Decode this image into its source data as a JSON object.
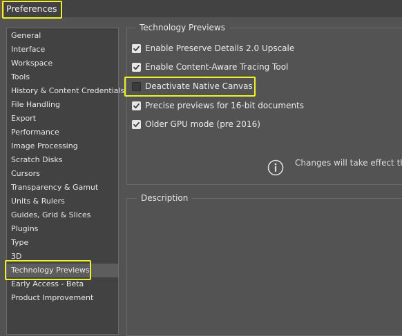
{
  "window": {
    "title": "Preferences"
  },
  "sidebar": {
    "items": [
      {
        "label": "General",
        "selected": false
      },
      {
        "label": "Interface",
        "selected": false
      },
      {
        "label": "Workspace",
        "selected": false
      },
      {
        "label": "Tools",
        "selected": false
      },
      {
        "label": "History & Content Credentials",
        "selected": false
      },
      {
        "label": "File Handling",
        "selected": false
      },
      {
        "label": "Export",
        "selected": false
      },
      {
        "label": "Performance",
        "selected": false
      },
      {
        "label": "Image Processing",
        "selected": false
      },
      {
        "label": "Scratch Disks",
        "selected": false
      },
      {
        "label": "Cursors",
        "selected": false
      },
      {
        "label": "Transparency & Gamut",
        "selected": false
      },
      {
        "label": "Units & Rulers",
        "selected": false
      },
      {
        "label": "Guides, Grid & Slices",
        "selected": false
      },
      {
        "label": "Plugins",
        "selected": false
      },
      {
        "label": "Type",
        "selected": false
      },
      {
        "label": "3D",
        "selected": false
      },
      {
        "label": "Technology Previews",
        "selected": true
      },
      {
        "label": "Early Access - Beta",
        "selected": false
      },
      {
        "label": "Product Improvement",
        "selected": false
      }
    ]
  },
  "tech_previews": {
    "legend": "Technology Previews",
    "options": [
      {
        "label": "Enable Preserve Details 2.0 Upscale",
        "checked": true
      },
      {
        "label": "Enable Content-Aware Tracing Tool",
        "checked": true
      },
      {
        "label": "Deactivate Native Canvas",
        "checked": false
      },
      {
        "label": "Precise previews for 16-bit documents",
        "checked": true
      },
      {
        "label": "Older GPU mode (pre 2016)",
        "checked": true
      }
    ],
    "info_text": "Changes will take effect the"
  },
  "description": {
    "legend": "Description"
  },
  "colors": {
    "highlight": "#f1f12a",
    "background": "#535353",
    "panel": "#424242"
  }
}
